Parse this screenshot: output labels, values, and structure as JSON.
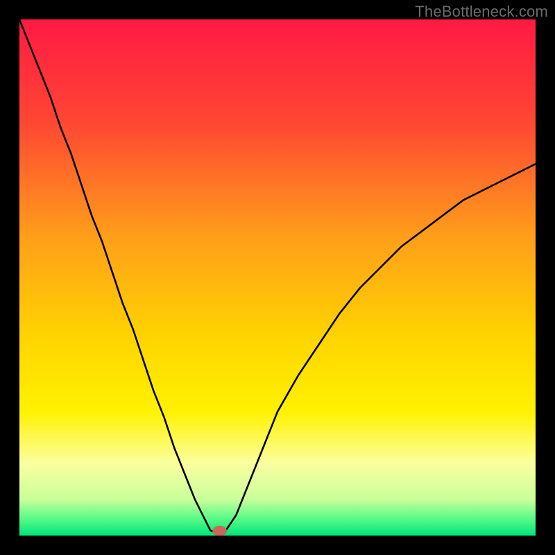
{
  "watermark": "TheBottleneck.com",
  "chart_data": {
    "type": "line",
    "title": "",
    "xlabel": "",
    "ylabel": "",
    "xlim": [
      0,
      100
    ],
    "ylim": [
      0,
      100
    ],
    "grid": false,
    "legend": false,
    "background_gradient": {
      "stops": [
        {
          "offset": 0.0,
          "color": "#ff1a43"
        },
        {
          "offset": 0.2,
          "color": "#ff4733"
        },
        {
          "offset": 0.42,
          "color": "#ff9e1a"
        },
        {
          "offset": 0.62,
          "color": "#ffd500"
        },
        {
          "offset": 0.76,
          "color": "#fff200"
        },
        {
          "offset": 0.86,
          "color": "#fbffa0"
        },
        {
          "offset": 0.93,
          "color": "#c9ff9a"
        },
        {
          "offset": 0.965,
          "color": "#5ffb8a"
        },
        {
          "offset": 1.0,
          "color": "#00e57a"
        }
      ]
    },
    "series": [
      {
        "name": "bottleneck-curve",
        "color": "#000000",
        "stroke_width": 2.6,
        "x": [
          0,
          2,
          4,
          6,
          8,
          10,
          12,
          14,
          16,
          18,
          20,
          22,
          24,
          26,
          28,
          30,
          32,
          34,
          36,
          37,
          38,
          39,
          40,
          42,
          44,
          46,
          48,
          50,
          54,
          58,
          62,
          66,
          70,
          74,
          78,
          82,
          86,
          90,
          94,
          98,
          100
        ],
        "y": [
          100,
          95,
          90,
          85,
          79,
          74,
          68,
          62,
          57,
          51,
          45,
          40,
          34,
          28,
          23,
          17,
          12,
          7,
          3,
          1,
          0.6,
          0.5,
          1,
          4,
          9,
          14,
          19,
          24,
          31,
          37,
          43,
          48,
          52,
          56,
          59,
          62,
          65,
          67,
          69,
          71,
          72
        ]
      }
    ],
    "marker": {
      "name": "optimal-point",
      "x": 38.8,
      "y": 0.9,
      "rx": 1.4,
      "ry": 1.0,
      "fill": "#c9675a"
    }
  }
}
